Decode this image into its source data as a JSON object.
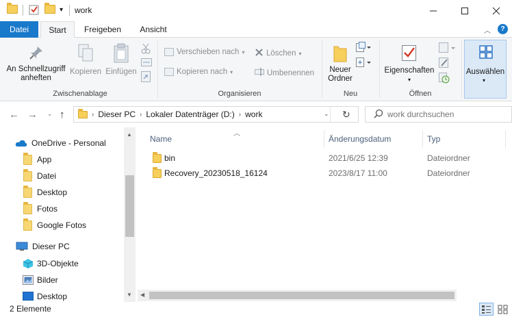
{
  "window": {
    "title": "work"
  },
  "tabs": {
    "file": "Datei",
    "start": "Start",
    "share": "Freigeben",
    "view": "Ansicht"
  },
  "ribbon": {
    "clipboard": {
      "pin_line1": "An Schnellzugriff",
      "pin_line2": "anheften",
      "copy": "Kopieren",
      "paste": "Einfügen",
      "label": "Zwischenablage"
    },
    "organize": {
      "move": "Verschieben nach",
      "copy_to": "Kopieren nach",
      "delete": "Löschen",
      "rename": "Umbenennen",
      "label": "Organisieren"
    },
    "new": {
      "folder_line1": "Neuer",
      "folder_line2": "Ordner",
      "label": "Neu"
    },
    "open": {
      "properties": "Eigenschaften",
      "label": "Öffnen"
    },
    "select": {
      "label": "Auswählen"
    }
  },
  "address": {
    "crumbs": [
      "Dieser PC",
      "Lokaler Datenträger (D:)",
      "work"
    ]
  },
  "search": {
    "placeholder": "work durchsuchen"
  },
  "nav": {
    "onedrive": "OneDrive - Personal",
    "onedrive_children": [
      "App",
      "Datei",
      "Desktop",
      "Fotos",
      "Google Fotos"
    ],
    "thispc": "Dieser PC",
    "thispc_children": [
      "3D-Objekte",
      "Bilder",
      "Desktop"
    ]
  },
  "columns": {
    "name": "Name",
    "date": "Änderungsdatum",
    "type": "Typ"
  },
  "files": [
    {
      "name": "bin",
      "date": "2021/6/25 12:39",
      "type": "Dateiordner"
    },
    {
      "name": "Recovery_20230518_16124",
      "date": "2023/8/17 11:00",
      "type": "Dateiordner"
    }
  ],
  "status": {
    "count": "2 Elemente"
  },
  "colors": {
    "accent": "#1979ca",
    "folder": "#f7cf5b",
    "ribbon_bg": "#f5f6f7"
  }
}
